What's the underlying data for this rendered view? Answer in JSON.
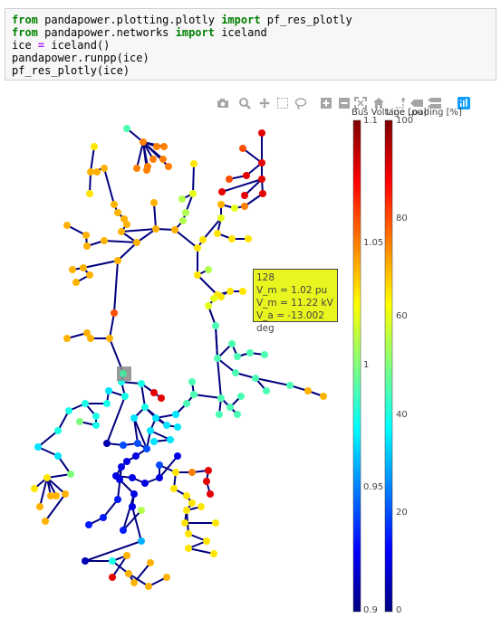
{
  "code": {
    "lines": [
      [
        {
          "t": "from",
          "c": "kw"
        },
        {
          "t": " pandapower.plotting.plotly ",
          "c": ""
        },
        {
          "t": "import",
          "c": "kw"
        },
        {
          "t": " pf_res_plotly",
          "c": ""
        }
      ],
      [
        {
          "t": "from",
          "c": "kw"
        },
        {
          "t": " pandapower.networks ",
          "c": ""
        },
        {
          "t": "import",
          "c": "kw"
        },
        {
          "t": " iceland",
          "c": ""
        }
      ],
      [
        {
          "t": "ice ",
          "c": ""
        },
        {
          "t": "=",
          "c": "op"
        },
        {
          "t": " iceland()",
          "c": ""
        }
      ],
      [
        {
          "t": "pandapower.runpp(ice)",
          "c": ""
        }
      ],
      [
        {
          "t": "pf_res_plotly(ice)",
          "c": ""
        }
      ]
    ]
  },
  "toolbar": {
    "buttons": [
      {
        "name": "camera-icon",
        "label": "Download plot as png"
      },
      {
        "name": "zoom-icon",
        "label": "Zoom"
      },
      {
        "name": "pan-icon",
        "label": "Pan"
      },
      {
        "name": "box-select-icon",
        "label": "Box Select"
      },
      {
        "name": "lasso-select-icon",
        "label": "Lasso Select"
      },
      {
        "name": "zoom-in-icon",
        "label": "Zoom in"
      },
      {
        "name": "zoom-out-icon",
        "label": "Zoom out"
      },
      {
        "name": "autoscale-icon",
        "label": "Autoscale"
      },
      {
        "name": "reset-axes-icon",
        "label": "Reset axes"
      },
      {
        "name": "spike-lines-icon",
        "label": "Toggle Spike Lines"
      },
      {
        "name": "hover-closest-icon",
        "label": "Show closest data on hover"
      },
      {
        "name": "hover-compare-icon",
        "label": "Compare data on hover"
      },
      {
        "name": "plotly-logo-icon",
        "label": "Produced with Plotly"
      }
    ]
  },
  "colorbars": {
    "bus": {
      "title": "Bus Voltage [pu]",
      "ticks": [
        "1.1",
        "1.05",
        "1",
        "0.95",
        "0.9"
      ]
    },
    "line": {
      "title": "Line Loading [%]",
      "ticks": [
        "100",
        "80",
        "60",
        "40",
        "20",
        "0"
      ]
    }
  },
  "tooltip": {
    "lines": [
      "128",
      "V_m = 1.02 pu",
      "V_m = 11.22 kV",
      "V_a = -13.002 deg"
    ]
  },
  "chart_data": {
    "type": "scatter",
    "description_of_encoding": "",
    "bus_voltage_range": [
      0.9,
      1.1
    ],
    "line_loading_range": [
      0,
      100
    ],
    "highlighted_bus": "128",
    "buses": [
      [
        140,
        142,
        0.99
      ],
      [
        158,
        157,
        1.05
      ],
      [
        173,
        162,
        1.05
      ],
      [
        181,
        162,
        1.05
      ],
      [
        180,
        176,
        1.05
      ],
      [
        186,
        184,
        1.05
      ],
      [
        169,
        176,
        1.05
      ],
      [
        163,
        184,
        1.05
      ],
      [
        151,
        186,
        1.05
      ],
      [
        162,
        188,
        1.05
      ],
      [
        104,
        162,
        1.03
      ],
      [
        100,
        190,
        1.04
      ],
      [
        107,
        190,
        1.04
      ],
      [
        99,
        214,
        1.03
      ],
      [
        115,
        186,
        1.04
      ],
      [
        214,
        181,
        1.03
      ],
      [
        213,
        214,
        1.02
      ],
      [
        201,
        220,
        1.01
      ],
      [
        205,
        235,
        1.01
      ],
      [
        202,
        244,
        1.01
      ],
      [
        289,
        147,
        1.08
      ],
      [
        289,
        180,
        1.08
      ],
      [
        268,
        164,
        1.06
      ],
      [
        272,
        194,
        1.08
      ],
      [
        253,
        198,
        1.06
      ],
      [
        289,
        198,
        1.08
      ],
      [
        245,
        212,
        1.08
      ],
      [
        270,
        216,
        1.08
      ],
      [
        290,
        214,
        1.08
      ],
      [
        270,
        228,
        1.05
      ],
      [
        259,
        230,
        1.02
      ],
      [
        244,
        226,
        1.04
      ],
      [
        240,
        258,
        1.03
      ],
      [
        256,
        264,
        1.03
      ],
      [
        274,
        264,
        1.03
      ],
      [
        224,
        265,
        1.03
      ],
      [
        244,
        241,
        1.02
      ],
      [
        74,
        249,
        1.04
      ],
      [
        95,
        260,
        1.04
      ],
      [
        96,
        272,
        1.04
      ],
      [
        115,
        266,
        1.04
      ],
      [
        151,
        268,
        1.04
      ],
      [
        172,
        253,
        1.04
      ],
      [
        193,
        254,
        1.04
      ],
      [
        134,
        256,
        1.04
      ],
      [
        140,
        248,
        1.04
      ],
      [
        137,
        242,
        1.04
      ],
      [
        130,
        235,
        1.04
      ],
      [
        126,
        226,
        1.04
      ],
      [
        170,
        224,
        1.04
      ],
      [
        80,
        298,
        1.04
      ],
      [
        92,
        296,
        1.04
      ],
      [
        99,
        304,
        1.04
      ],
      [
        84,
        312,
        1.04
      ],
      [
        130,
        288,
        1.04
      ],
      [
        126,
        346,
        1.06
      ],
      [
        74,
        374,
        1.04
      ],
      [
        96,
        368,
        1.04
      ],
      [
        100,
        374,
        1.04
      ],
      [
        121,
        374,
        1.04
      ],
      [
        218,
        274,
        1.03
      ],
      [
        218,
        304,
        1.03
      ],
      [
        230,
        298,
        1.01
      ],
      [
        240,
        326,
        1.03
      ],
      [
        254,
        322,
        1.03
      ],
      [
        268,
        322,
        1.03
      ],
      [
        244,
        328,
        1.03
      ],
      [
        230,
        338,
        1.02
      ],
      [
        238,
        360,
        0.99
      ],
      [
        240,
        396,
        0.99
      ],
      [
        256,
        380,
        0.99
      ],
      [
        262,
        394,
        0.99
      ],
      [
        276,
        390,
        0.99
      ],
      [
        292,
        392,
        0.99
      ],
      [
        260,
        412,
        0.99
      ],
      [
        282,
        418,
        0.99
      ],
      [
        294,
        432,
        0.99
      ],
      [
        320,
        426,
        0.99
      ],
      [
        340,
        432,
        1.04
      ],
      [
        357,
        438,
        1.04
      ],
      [
        244,
        440,
        0.99
      ],
      [
        254,
        450,
        0.99
      ],
      [
        266,
        438,
        0.99
      ],
      [
        262,
        458,
        0.99
      ],
      [
        242,
        458,
        0.99
      ],
      [
        214,
        436,
        0.99
      ],
      [
        206,
        446,
        0.99
      ],
      [
        212,
        422,
        0.99
      ],
      [
        194,
        458,
        0.97
      ],
      [
        172,
        462,
        0.97
      ],
      [
        184,
        470,
        0.97
      ],
      [
        196,
        472,
        0.97
      ],
      [
        166,
        476,
        0.97
      ],
      [
        188,
        486,
        0.97
      ],
      [
        170,
        488,
        0.97
      ],
      [
        136,
        412,
        1.0
      ],
      [
        134,
        422,
        0.98
      ],
      [
        156,
        424,
        0.98
      ],
      [
        170,
        434,
        1.08
      ],
      [
        178,
        440,
        1.08
      ],
      [
        138,
        438,
        0.98
      ],
      [
        120,
        432,
        0.97
      ],
      [
        118,
        446,
        0.98
      ],
      [
        94,
        446,
        0.98
      ],
      [
        106,
        460,
        0.98
      ],
      [
        106,
        470,
        0.98
      ],
      [
        88,
        466,
        1.0
      ],
      [
        76,
        454,
        0.98
      ],
      [
        64,
        476,
        0.98
      ],
      [
        42,
        494,
        0.97
      ],
      [
        64,
        504,
        0.97
      ],
      [
        78,
        524,
        1.0
      ],
      [
        52,
        528,
        1.03
      ],
      [
        38,
        540,
        1.03
      ],
      [
        56,
        548,
        1.04
      ],
      [
        62,
        548,
        1.04
      ],
      [
        72,
        546,
        1.04
      ],
      [
        44,
        560,
        1.04
      ],
      [
        50,
        576,
        1.04
      ],
      [
        118,
        490,
        0.91
      ],
      [
        136,
        492,
        0.94
      ],
      [
        152,
        490,
        0.94
      ],
      [
        162,
        496,
        0.94
      ],
      [
        150,
        504,
        0.92
      ],
      [
        140,
        510,
        0.92
      ],
      [
        134,
        516,
        0.92
      ],
      [
        128,
        526,
        0.92
      ],
      [
        146,
        528,
        0.92
      ],
      [
        160,
        534,
        0.92
      ],
      [
        176,
        528,
        0.92
      ],
      [
        148,
        546,
        0.92
      ],
      [
        146,
        560,
        0.92
      ],
      [
        176,
        514,
        0.94
      ],
      [
        194,
        522,
        1.03
      ],
      [
        212,
        522,
        1.05
      ],
      [
        230,
        520,
        1.08
      ],
      [
        228,
        532,
        1.08
      ],
      [
        232,
        546,
        1.08
      ],
      [
        192,
        540,
        1.03
      ],
      [
        206,
        548,
        1.03
      ],
      [
        212,
        556,
        1.03
      ],
      [
        206,
        564,
        1.03
      ],
      [
        222,
        560,
        1.03
      ],
      [
        204,
        578,
        1.03
      ],
      [
        238,
        578,
        1.03
      ],
      [
        208,
        590,
        1.03
      ],
      [
        228,
        598,
        1.03
      ],
      [
        208,
        606,
        1.03
      ],
      [
        236,
        612,
        1.03
      ],
      [
        196,
        504,
        0.92
      ],
      [
        130,
        552,
        0.93
      ],
      [
        114,
        572,
        0.93
      ],
      [
        98,
        580,
        0.93
      ],
      [
        136,
        586,
        0.93
      ],
      [
        156,
        564,
        1.01
      ],
      [
        156,
        598,
        0.96
      ],
      [
        94,
        620,
        0.91
      ],
      [
        124,
        620,
        0.98
      ],
      [
        140,
        614,
        1.04
      ],
      [
        124,
        638,
        1.08
      ],
      [
        142,
        634,
        1.04
      ],
      [
        148,
        644,
        1.04
      ],
      [
        166,
        622,
        1.04
      ],
      [
        164,
        648,
        1.04
      ],
      [
        184,
        638,
        1.04
      ],
      [
        132,
        530,
        0.92
      ],
      [
        160,
        450,
        0.98
      ],
      [
        148,
        462,
        0.97
      ],
      [
        236,
        330,
        1.02
      ]
    ],
    "lines": [
      [
        0,
        1
      ],
      [
        1,
        2
      ],
      [
        1,
        3
      ],
      [
        1,
        4
      ],
      [
        1,
        5
      ],
      [
        1,
        6
      ],
      [
        1,
        7
      ],
      [
        1,
        8
      ],
      [
        1,
        9
      ],
      [
        10,
        11
      ],
      [
        11,
        12
      ],
      [
        11,
        13
      ],
      [
        11,
        14
      ],
      [
        14,
        48
      ],
      [
        48,
        47
      ],
      [
        47,
        46
      ],
      [
        46,
        45
      ],
      [
        45,
        44
      ],
      [
        44,
        42
      ],
      [
        42,
        43
      ],
      [
        49,
        42
      ],
      [
        15,
        16
      ],
      [
        16,
        17
      ],
      [
        16,
        18
      ],
      [
        18,
        19
      ],
      [
        19,
        43
      ],
      [
        20,
        21
      ],
      [
        21,
        22
      ],
      [
        21,
        23
      ],
      [
        23,
        24
      ],
      [
        21,
        25
      ],
      [
        25,
        26
      ],
      [
        25,
        27
      ],
      [
        25,
        28
      ],
      [
        28,
        29
      ],
      [
        29,
        30
      ],
      [
        30,
        31
      ],
      [
        31,
        36
      ],
      [
        36,
        32
      ],
      [
        32,
        33
      ],
      [
        33,
        34
      ],
      [
        36,
        35
      ],
      [
        35,
        60
      ],
      [
        43,
        60
      ],
      [
        37,
        38
      ],
      [
        38,
        39
      ],
      [
        39,
        40
      ],
      [
        40,
        41
      ],
      [
        41,
        42
      ],
      [
        44,
        41
      ],
      [
        54,
        41
      ],
      [
        50,
        51
      ],
      [
        51,
        52
      ],
      [
        52,
        53
      ],
      [
        51,
        54
      ],
      [
        54,
        55
      ],
      [
        56,
        57
      ],
      [
        57,
        58
      ],
      [
        58,
        59
      ],
      [
        55,
        59
      ],
      [
        59,
        95
      ],
      [
        60,
        61
      ],
      [
        61,
        62
      ],
      [
        61,
        63
      ],
      [
        63,
        64
      ],
      [
        64,
        65
      ],
      [
        63,
        66
      ],
      [
        63,
        67
      ],
      [
        67,
        68
      ],
      [
        68,
        69
      ],
      [
        69,
        70
      ],
      [
        70,
        71
      ],
      [
        71,
        72
      ],
      [
        72,
        73
      ],
      [
        69,
        74
      ],
      [
        74,
        75
      ],
      [
        75,
        76
      ],
      [
        75,
        77
      ],
      [
        77,
        78
      ],
      [
        78,
        79
      ],
      [
        69,
        80
      ],
      [
        80,
        81
      ],
      [
        81,
        82
      ],
      [
        81,
        83
      ],
      [
        80,
        84
      ],
      [
        80,
        85
      ],
      [
        85,
        86
      ],
      [
        85,
        87
      ],
      [
        86,
        88
      ],
      [
        88,
        89
      ],
      [
        89,
        90
      ],
      [
        90,
        91
      ],
      [
        89,
        92
      ],
      [
        92,
        93
      ],
      [
        93,
        94
      ],
      [
        95,
        96
      ],
      [
        96,
        97
      ],
      [
        97,
        98
      ],
      [
        98,
        99
      ],
      [
        96,
        100
      ],
      [
        100,
        101
      ],
      [
        101,
        102
      ],
      [
        102,
        103
      ],
      [
        103,
        104
      ],
      [
        104,
        105
      ],
      [
        105,
        106
      ],
      [
        103,
        107
      ],
      [
        107,
        108
      ],
      [
        108,
        109
      ],
      [
        109,
        110
      ],
      [
        110,
        111
      ],
      [
        111,
        112
      ],
      [
        112,
        113
      ],
      [
        112,
        114
      ],
      [
        112,
        115
      ],
      [
        112,
        116
      ],
      [
        112,
        117
      ],
      [
        116,
        118
      ],
      [
        100,
        119
      ],
      [
        119,
        120
      ],
      [
        120,
        121
      ],
      [
        121,
        122
      ],
      [
        122,
        123
      ],
      [
        123,
        124
      ],
      [
        124,
        125
      ],
      [
        125,
        126
      ],
      [
        126,
        127
      ],
      [
        127,
        128
      ],
      [
        128,
        129
      ],
      [
        126,
        130
      ],
      [
        130,
        131
      ],
      [
        129,
        132
      ],
      [
        132,
        133
      ],
      [
        133,
        134
      ],
      [
        134,
        135
      ],
      [
        135,
        136
      ],
      [
        136,
        137
      ],
      [
        133,
        138
      ],
      [
        138,
        139
      ],
      [
        139,
        140
      ],
      [
        140,
        141
      ],
      [
        141,
        142
      ],
      [
        141,
        143
      ],
      [
        143,
        144
      ],
      [
        141,
        145
      ],
      [
        145,
        146
      ],
      [
        146,
        147
      ],
      [
        147,
        148
      ],
      [
        129,
        149
      ],
      [
        125,
        150
      ],
      [
        150,
        151
      ],
      [
        151,
        152
      ],
      [
        130,
        153
      ],
      [
        153,
        154
      ],
      [
        131,
        155
      ],
      [
        155,
        156
      ],
      [
        156,
        157
      ],
      [
        157,
        158
      ],
      [
        158,
        159
      ],
      [
        157,
        160
      ],
      [
        160,
        161
      ],
      [
        161,
        162
      ],
      [
        160,
        163
      ],
      [
        163,
        164
      ],
      [
        125,
        165
      ],
      [
        97,
        166
      ],
      [
        166,
        167
      ],
      [
        166,
        90
      ],
      [
        167,
        121
      ],
      [
        167,
        122
      ],
      [
        92,
        122
      ],
      [
        89,
        166
      ],
      [
        68,
        69
      ],
      [
        64,
        168
      ]
    ]
  }
}
